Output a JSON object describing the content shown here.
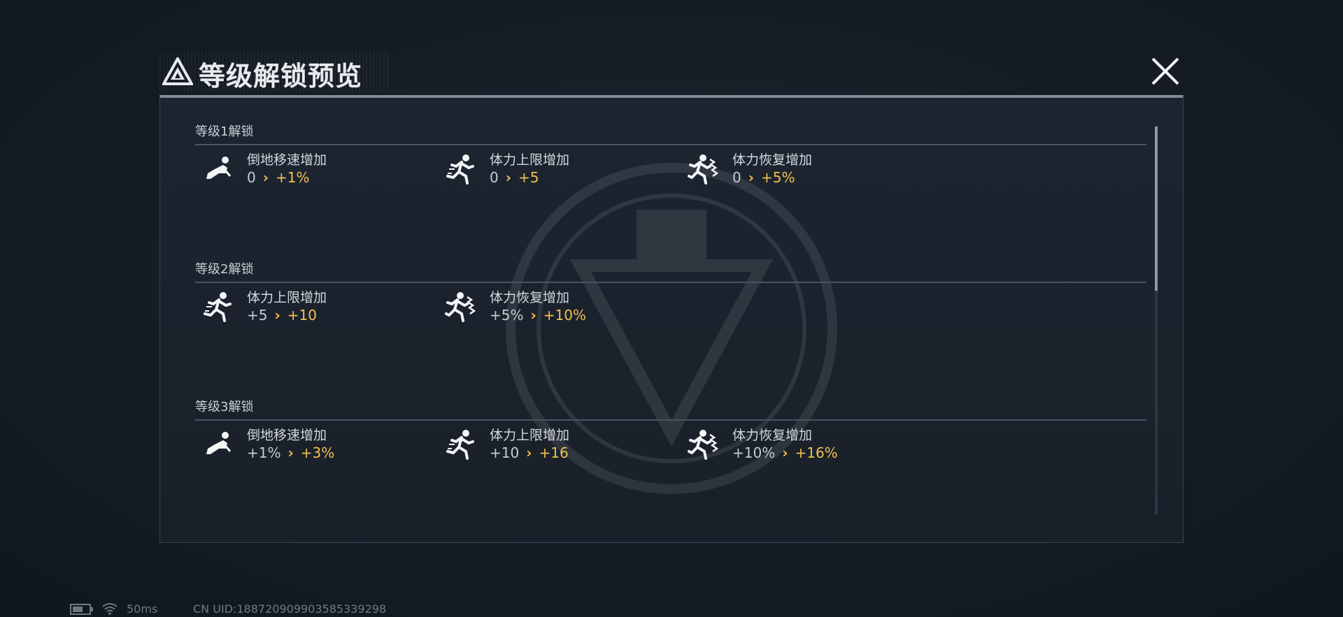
{
  "title": "等级解锁预览",
  "levels": [
    {
      "title": "等级1解锁",
      "entries": [
        {
          "icon": "crawl-icon",
          "name": "倒地移速增加",
          "from": "0",
          "to": "+1%"
        },
        {
          "icon": "sprint-icon",
          "name": "体力上限增加",
          "from": "0",
          "to": "+5"
        },
        {
          "icon": "stamina-recovery-icon",
          "name": "体力恢复增加",
          "from": "0",
          "to": "+5%"
        }
      ]
    },
    {
      "title": "等级2解锁",
      "entries": [
        {
          "icon": "sprint-icon",
          "name": "体力上限增加",
          "from": "+5",
          "to": "+10"
        },
        {
          "icon": "stamina-recovery-icon",
          "name": "体力恢复增加",
          "from": "+5%",
          "to": "+10%"
        }
      ]
    },
    {
      "title": "等级3解锁",
      "entries": [
        {
          "icon": "crawl-icon",
          "name": "倒地移速增加",
          "from": "+1%",
          "to": "+3%"
        },
        {
          "icon": "sprint-icon",
          "name": "体力上限增加",
          "from": "+10",
          "to": "+16"
        },
        {
          "icon": "stamina-recovery-icon",
          "name": "体力恢复增加",
          "from": "+10%",
          "to": "+16%"
        }
      ]
    }
  ],
  "arrow_glyph": "›",
  "status": {
    "ping": "50ms",
    "uid": "CN UID:188720909903585339298"
  },
  "colors": {
    "accent": "#f2c14e",
    "panel_bg": "#1b222c",
    "text": "#d3d8de"
  }
}
